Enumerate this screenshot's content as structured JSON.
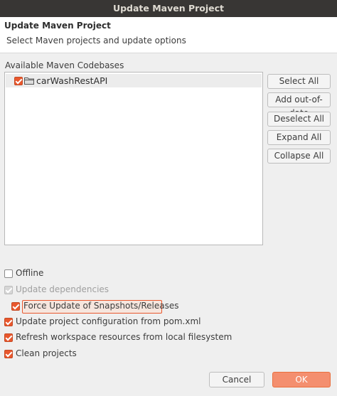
{
  "window": {
    "title": "Update Maven Project"
  },
  "header": {
    "title": "Update Maven Project",
    "message": "Select Maven projects and update options"
  },
  "codebases": {
    "label": "Available Maven Codebases",
    "items": [
      {
        "name": "carWashRestAPI",
        "checked": true
      }
    ]
  },
  "side_buttons": {
    "select_all": "Select All",
    "add_out_of_date": "Add out-of-date",
    "deselect_all": "Deselect All",
    "expand_all": "Expand All",
    "collapse_all": "Collapse All"
  },
  "options": {
    "offline": {
      "label": "Offline",
      "checked": false
    },
    "update_dependencies": {
      "label": "Update dependencies",
      "checked": true,
      "disabled": true
    },
    "force_update": {
      "label": "Force Update of Snapshots/Releases",
      "checked": true
    },
    "update_config": {
      "label": "Update project configuration from pom.xml",
      "checked": true
    },
    "refresh_workspace": {
      "label": "Refresh workspace resources from local filesystem",
      "checked": true
    },
    "clean_projects": {
      "label": "Clean projects",
      "checked": true
    }
  },
  "footer": {
    "cancel_label": "Cancel",
    "ok_label": "OK"
  },
  "colors": {
    "accent": "#e9572d",
    "titlebar": "#383634"
  }
}
